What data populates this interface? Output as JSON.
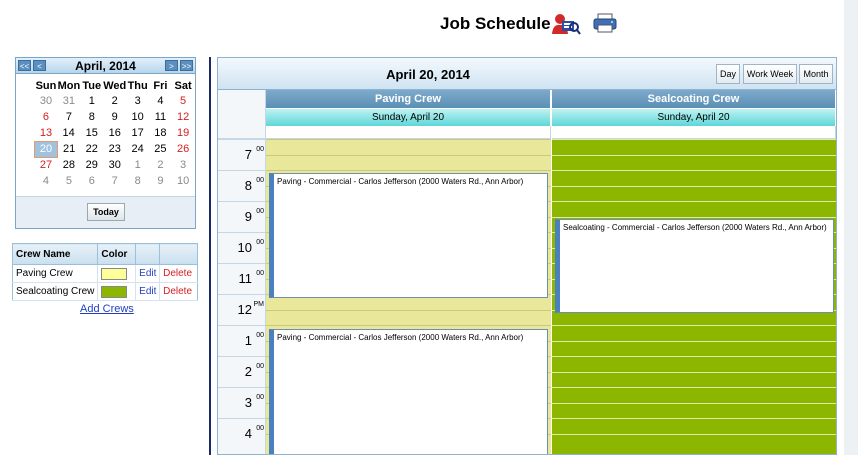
{
  "header": {
    "title": "Job Schedule",
    "icons": [
      "user-search-icon",
      "printer-icon"
    ]
  },
  "mini_calendar": {
    "title": "April, 2014",
    "nav": {
      "prev_year": "<<",
      "prev_month": "<",
      "next_month": ">",
      "next_year": ">>"
    },
    "weekdays": [
      "Sun",
      "Mon",
      "Tue",
      "Wed",
      "Thu",
      "Fri",
      "Sat"
    ],
    "weeks": [
      [
        "30",
        "31",
        "1",
        "2",
        "3",
        "4",
        "5"
      ],
      [
        "6",
        "7",
        "8",
        "9",
        "10",
        "11",
        "12"
      ],
      [
        "13",
        "14",
        "15",
        "16",
        "17",
        "18",
        "19"
      ],
      [
        "20",
        "21",
        "22",
        "23",
        "24",
        "25",
        "26"
      ],
      [
        "27",
        "28",
        "29",
        "30",
        "1",
        "2",
        "3"
      ],
      [
        "4",
        "5",
        "6",
        "7",
        "8",
        "9",
        "10"
      ]
    ],
    "selected": "20",
    "today_label": "Today"
  },
  "crews": {
    "headers": [
      "Crew Name",
      "Color"
    ],
    "rows": [
      {
        "name": "Paving Crew",
        "color": "#ffff99",
        "edit": "Edit",
        "delete": "Delete"
      },
      {
        "name": "Sealcoating Crew",
        "color": "#8db600",
        "edit": "Edit",
        "delete": "Delete"
      }
    ],
    "add_label": "Add Crews"
  },
  "scheduler": {
    "date_title": "April 20, 2014",
    "views": [
      "Day",
      "Work Week",
      "Month"
    ],
    "resources": [
      {
        "name": "Paving Crew",
        "day": "Sunday, April 20",
        "color": "#e8e79a"
      },
      {
        "name": "Sealcoating Crew",
        "day": "Sunday, April 20",
        "color": "#8db600"
      }
    ],
    "hours": [
      {
        "h": "7",
        "m": "00"
      },
      {
        "h": "8",
        "m": "00"
      },
      {
        "h": "9",
        "m": "00"
      },
      {
        "h": "10",
        "m": "00"
      },
      {
        "h": "11",
        "m": "00"
      },
      {
        "h": "12",
        "m": "PM"
      },
      {
        "h": "1",
        "m": "00"
      },
      {
        "h": "2",
        "m": "00"
      },
      {
        "h": "3",
        "m": "00"
      },
      {
        "h": "4",
        "m": "00"
      }
    ],
    "events": [
      {
        "text": "Paving - Commercial - Carlos Jefferson (2000 Waters Rd., Ann Arbor)"
      },
      {
        "text": "Sealcoating - Commercial - Carlos Jefferson (2000 Waters Rd., Ann Arbor)"
      },
      {
        "text": "Paving - Commercial - Carlos Jefferson (2000 Waters Rd., Ann Arbor)"
      }
    ]
  }
}
